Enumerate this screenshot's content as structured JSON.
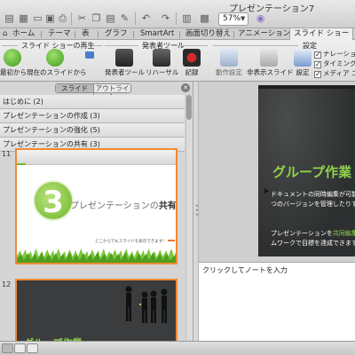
{
  "window": {
    "title": "プレゼンテーション7",
    "zoom": "57%"
  },
  "ribbon_tabs": [
    {
      "label": "ホーム"
    },
    {
      "label": "テーマ"
    },
    {
      "label": "表"
    },
    {
      "label": "グラフ"
    },
    {
      "label": "SmartArt"
    },
    {
      "label": "画面切り替え"
    },
    {
      "label": "アニメーション"
    },
    {
      "label": "スライド ショー"
    }
  ],
  "ribbon_groups": {
    "play": {
      "label": "スライド ショーの再生",
      "buttons": [
        "最初から",
        "現在のスライドから"
      ]
    },
    "presenter": {
      "label": "発表者ツール",
      "buttons": [
        "発表者ツール",
        "リハーサル",
        "記録"
      ]
    },
    "settings": {
      "label": "設定",
      "buttons": [
        "動作設定",
        "非表示スライド",
        "設定"
      ]
    },
    "options": [
      "ナレーション",
      "タイミング",
      "メディア コ"
    ]
  },
  "sidebar": {
    "seg_slides": "スライド",
    "seg_outline": "アウトライン",
    "sections": [
      "はじめに (2)",
      "プレゼンテーションの作成 (3)",
      "プレゼンテーションの強化 (5)",
      "プレゼンテーションの共有 (3)"
    ],
    "thumb1": {
      "num": "11",
      "number_glyph": "3",
      "title_plain": "プレゼンテーションの",
      "title_bold": "共有",
      "subtitle": "どこからでもスライドを表示できます!"
    },
    "thumb2": {
      "num": "12",
      "title": "グループ作業"
    }
  },
  "main_slide": {
    "heading": "グループ作業",
    "para1": "ドキュメントの同時編集が可能に他の人の作業が終わるのを待つのバージョンを管理したりする必ません。",
    "para2_pre": "プレゼンテーションを",
    "para2_hl": "共同編集",
    "para2_post": "ムワークで目標を達成できます。"
  },
  "notes": {
    "placeholder": "クリックしてノートを入力"
  },
  "colors": {
    "accent_green": "#8fd34a",
    "selection_orange": "#f08a36",
    "slide_dark": "#2d2f30"
  }
}
